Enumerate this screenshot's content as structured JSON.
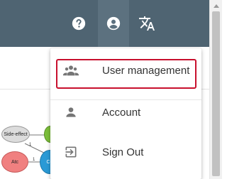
{
  "menu": {
    "items": [
      {
        "label": "User management",
        "icon": "user-group-icon"
      },
      {
        "label": "Account",
        "icon": "person-icon"
      },
      {
        "label": "Sign Out",
        "icon": "exit-icon"
      }
    ]
  },
  "diagram": {
    "nodes": [
      {
        "label": "Side-effect"
      },
      {
        "label": "Atc"
      },
      {
        "label": "Co"
      },
      {
        "label": ""
      }
    ],
    "edge_labels": [
      "1",
      "1"
    ]
  },
  "colors": {
    "topbar": "#4f6472",
    "highlight_border": "#c8102e",
    "icon_gray": "#757575"
  }
}
